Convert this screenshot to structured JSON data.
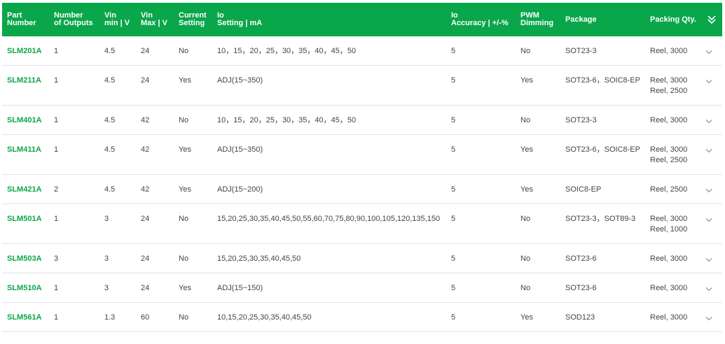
{
  "columns": [
    {
      "key": "part",
      "lines": [
        "Part",
        "Number"
      ]
    },
    {
      "key": "outputs",
      "lines": [
        "Number",
        "of Outputs"
      ]
    },
    {
      "key": "vin_min",
      "lines": [
        "Vin",
        "min | V"
      ]
    },
    {
      "key": "vin_max",
      "lines": [
        "Vin",
        "Max | V"
      ]
    },
    {
      "key": "current",
      "lines": [
        "Current",
        "Setting"
      ]
    },
    {
      "key": "io",
      "lines": [
        "Io",
        "Setting | mA"
      ]
    },
    {
      "key": "acc",
      "lines": [
        "Io",
        "Accuracy | +/-%"
      ]
    },
    {
      "key": "pwm",
      "lines": [
        "PWM",
        "Dimming"
      ]
    },
    {
      "key": "pkg",
      "lines": [
        "Package"
      ]
    },
    {
      "key": "pack",
      "lines": [
        "Packing Qty."
      ]
    }
  ],
  "colors": {
    "header_bg": "#0aa64a",
    "part_link": "#0aa64a",
    "text": "#444444",
    "divider": "#e3e3e3",
    "chevron": "#9a9a9a"
  },
  "icons": {
    "header_action": "double-chevron-down-icon",
    "row_action": "chevron-down-icon"
  },
  "rows": [
    {
      "part": "SLM201A",
      "outputs": "1",
      "vin_min": "4.5",
      "vin_max": "24",
      "current": "No",
      "io": "10，15，20，25，30，35，40，45，50",
      "acc": "5",
      "pwm": "No",
      "pkg": "SOT23-3",
      "pack": [
        "Reel, 3000"
      ]
    },
    {
      "part": "SLM211A",
      "outputs": "1",
      "vin_min": "4.5",
      "vin_max": "24",
      "current": "Yes",
      "io": "ADJ(15~350)",
      "acc": "5",
      "pwm": "Yes",
      "pkg": "SOT23-6，SOIC8-EP",
      "pack": [
        "Reel, 3000",
        "Reel, 2500"
      ]
    },
    {
      "part": "SLM401A",
      "outputs": "1",
      "vin_min": "4.5",
      "vin_max": "42",
      "current": "No",
      "io": "10，15，20，25，30，35，40，45，50",
      "acc": "5",
      "pwm": "No",
      "pkg": "SOT23-3",
      "pack": [
        "Reel, 3000"
      ]
    },
    {
      "part": "SLM411A",
      "outputs": "1",
      "vin_min": "4.5",
      "vin_max": "42",
      "current": "Yes",
      "io": "ADJ(15~350)",
      "acc": "5",
      "pwm": "Yes",
      "pkg": "SOT23-6，SOIC8-EP",
      "pack": [
        "Reel, 3000",
        "Reel, 2500"
      ]
    },
    {
      "part": "SLM421A",
      "outputs": "2",
      "vin_min": "4.5",
      "vin_max": "42",
      "current": "Yes",
      "io": "ADJ(15~200)",
      "acc": "5",
      "pwm": "Yes",
      "pkg": "SOIC8-EP",
      "pack": [
        "Reel, 2500"
      ]
    },
    {
      "part": "SLM501A",
      "outputs": "1",
      "vin_min": "3",
      "vin_max": "24",
      "current": "No",
      "io": "15,20,25,30,35,40,45,50,55,60,70,75,80,90,100,105,120,135,150",
      "acc": "5",
      "pwm": "No",
      "pkg": "SOT23-3，SOT89-3",
      "pack": [
        "Reel, 3000",
        "Reel, 1000"
      ]
    },
    {
      "part": "SLM503A",
      "outputs": "3",
      "vin_min": "3",
      "vin_max": "24",
      "current": "No",
      "io": "15,20,25,30,35,40,45,50",
      "acc": "5",
      "pwm": "No",
      "pkg": "SOT23-6",
      "pack": [
        "Reel, 3000"
      ]
    },
    {
      "part": "SLM510A",
      "outputs": "1",
      "vin_min": "3",
      "vin_max": "24",
      "current": "Yes",
      "io": "ADJ(15~150)",
      "acc": "5",
      "pwm": "No",
      "pkg": "SOT23-6",
      "pack": [
        "Reel, 3000"
      ]
    },
    {
      "part": "SLM561A",
      "outputs": "1",
      "vin_min": "1.3",
      "vin_max": "60",
      "current": "No",
      "io": "10,15,20,25,30,35,40,45,50",
      "acc": "5",
      "pwm": "Yes",
      "pkg": "SOD123",
      "pack": [
        "Reel, 3000"
      ]
    }
  ]
}
